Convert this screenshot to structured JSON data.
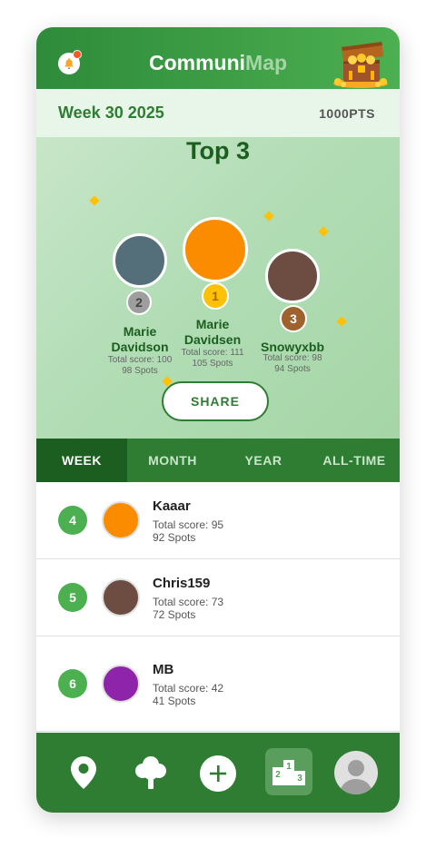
{
  "header": {
    "title_part1": "Communi",
    "title_part2": "Map"
  },
  "week_bar": {
    "week_label": "Week 30 2025",
    "points": "1000PTS"
  },
  "podium": {
    "heading": "Top 3",
    "entries": [
      {
        "rank": "2",
        "name_line1": "Marie",
        "name_line2": "Davidson",
        "score": "Total score: 100",
        "spots": "98 Spots",
        "avatar_color": "#546e7a",
        "badge_color": "#9e9e9e"
      },
      {
        "rank": "1",
        "name_line1": "Marie",
        "name_line2": "Davidsen",
        "score": "Total score: 111",
        "spots": "105 Spots",
        "avatar_color": "#fb8c00",
        "badge_color": "#ffc107"
      },
      {
        "rank": "3",
        "name_line1": "Snowyxbb",
        "name_line2": "",
        "score": "Total score: 98",
        "spots": "94 Spots",
        "avatar_color": "#6d4c41",
        "badge_color": "#a0622d"
      }
    ],
    "share_label": "SHARE"
  },
  "tabs": [
    {
      "label": "WEEK",
      "active": true
    },
    {
      "label": "MONTH",
      "active": false
    },
    {
      "label": "YEAR",
      "active": false
    },
    {
      "label": "ALL-TIME",
      "active": false
    }
  ],
  "leaderboard": [
    {
      "rank": "4",
      "name": "Kaaar",
      "score": "Total score: 95",
      "spots": "92 Spots",
      "avatar_color": "#fb8c00"
    },
    {
      "rank": "5",
      "name": "Chris159",
      "score": "Total score: 73",
      "spots": "72 Spots",
      "avatar_color": "#6d4c41"
    },
    {
      "rank": "6",
      "name": "MB",
      "score": "Total score: 42",
      "spots": "41 Spots",
      "avatar_color": "#8e24aa"
    }
  ],
  "nav": {
    "items": [
      "map-pin-icon",
      "tree-icon",
      "add-icon",
      "leaderboard-icon",
      "profile-icon"
    ],
    "active": "leaderboard-icon"
  },
  "colors": {
    "primary": "#2e7d32",
    "primary_dark": "#1b5e20",
    "accent_gold": "#ffc107",
    "rank_badge": "#4caf50"
  }
}
